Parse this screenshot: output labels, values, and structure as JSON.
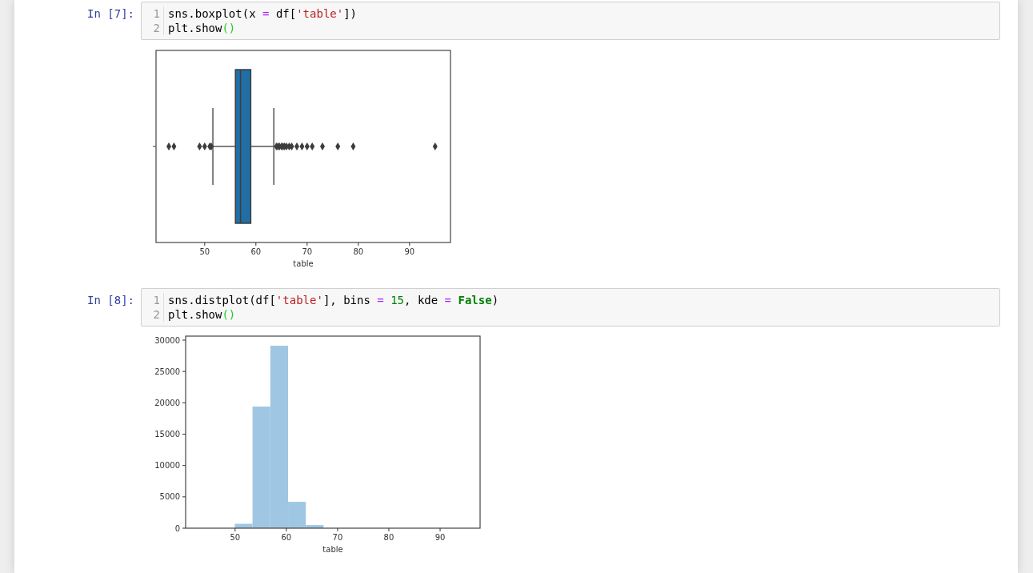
{
  "cells": [
    {
      "prompt": "In [7]:",
      "lines": [
        [
          {
            "text": "sns.boxplot(x ",
            "kind": "plain"
          },
          {
            "text": "= ",
            "kind": "operator"
          },
          {
            "text": "df[",
            "kind": "plain"
          },
          {
            "text": "'table'",
            "kind": "string"
          },
          {
            "text": "])",
            "kind": "plain"
          }
        ],
        [
          {
            "text": "plt.show",
            "kind": "plain"
          },
          {
            "text": "()",
            "kind": "bracket"
          }
        ]
      ],
      "line_numbers": [
        "1",
        "2"
      ],
      "output": {
        "kind": "boxplot",
        "x_ticks": [
          "50",
          "60",
          "70",
          "80",
          "90"
        ],
        "x_label": "table"
      }
    },
    {
      "prompt": "In [8]:",
      "lines": [
        [
          {
            "text": "sns.distplot(df[",
            "kind": "plain"
          },
          {
            "text": "'table'",
            "kind": "string"
          },
          {
            "text": "], bins ",
            "kind": "plain"
          },
          {
            "text": "= ",
            "kind": "operator"
          },
          {
            "text": "15",
            "kind": "number"
          },
          {
            "text": ", kde ",
            "kind": "plain"
          },
          {
            "text": "= ",
            "kind": "operator"
          },
          {
            "text": "False",
            "kind": "keyword"
          },
          {
            "text": ")",
            "kind": "plain"
          }
        ],
        [
          {
            "text": "plt.show",
            "kind": "plain"
          },
          {
            "text": "()",
            "kind": "bracket"
          }
        ]
      ],
      "line_numbers": [
        "1",
        "2"
      ],
      "output": {
        "kind": "chart",
        "chart_data": {
          "type": "bar",
          "xlabel": "table",
          "xlim": [
            40.35,
            97.8
          ],
          "ylim": [
            0,
            30640
          ],
          "xticks": [
            50,
            60,
            70,
            80,
            90
          ],
          "yticks": [
            0,
            5000,
            10000,
            15000,
            20000,
            25000,
            30000
          ],
          "x": [
            51.67,
            55.13,
            58.6,
            62.07,
            65.53
          ],
          "series": [
            {
              "color": "#9fc6e2",
              "values": [
                700,
                19400,
                29100,
                4200,
                500
              ]
            }
          ]
        }
      }
    }
  ]
}
